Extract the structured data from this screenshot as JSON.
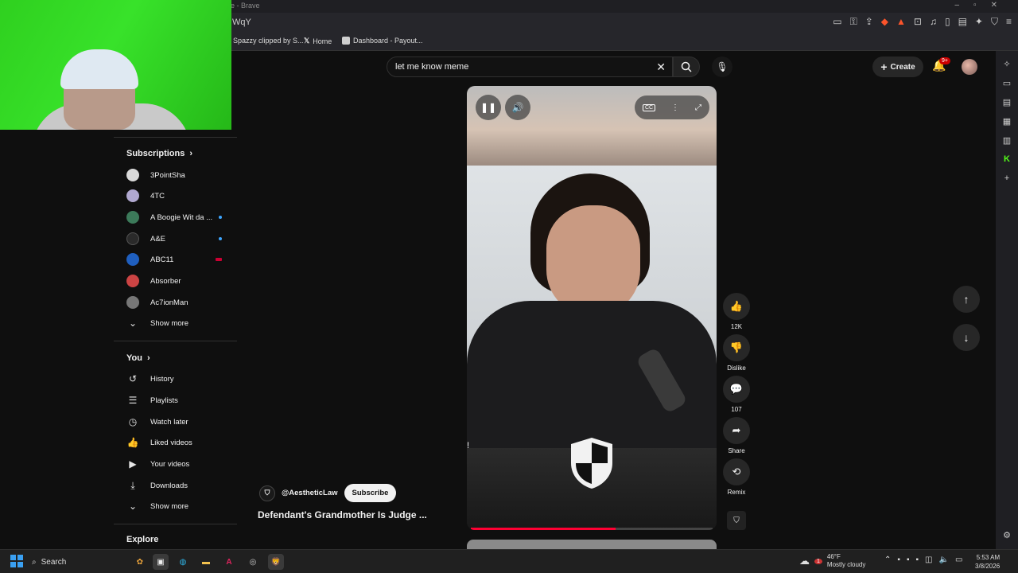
{
  "browser": {
    "window_title": "e - Brave",
    "url_fragment": "WqY",
    "bookmarks": [
      {
        "label": "Spazzy clipped by S..."
      },
      {
        "label": "Home"
      },
      {
        "label": "Dashboard - Payout..."
      }
    ]
  },
  "header": {
    "search_query": "let me know meme",
    "create_label": "Create",
    "notification_badge": "9+"
  },
  "sidebar": {
    "subscriptions_title": "Subscriptions",
    "subscriptions": [
      {
        "label": "3PointSha",
        "color": "#d9d9d9"
      },
      {
        "label": "4TC",
        "color": "#b0a8d0"
      },
      {
        "label": "A Boogie Wit da ...",
        "color": "#3c7a5a"
      },
      {
        "label": "A&E",
        "color": "#2a2a2a"
      },
      {
        "label": "ABC11",
        "color": "#1f5fbf"
      },
      {
        "label": "Absorber",
        "color": "#c44"
      },
      {
        "label": "Ac7ionMan",
        "color": "#777"
      }
    ],
    "subs_show_more": "Show more",
    "you_title": "You",
    "you_items": [
      {
        "label": "History",
        "icon": "history-icon"
      },
      {
        "label": "Playlists",
        "icon": "playlists-icon"
      },
      {
        "label": "Watch later",
        "icon": "watch-later-icon"
      },
      {
        "label": "Liked videos",
        "icon": "liked-videos-icon"
      },
      {
        "label": "Your videos",
        "icon": "your-videos-icon"
      },
      {
        "label": "Downloads",
        "icon": "downloads-icon"
      }
    ],
    "you_show_more": "Show more",
    "explore_title": "Explore"
  },
  "video": {
    "channel": "@AestheticLaw",
    "subscribe_label": "Subscribe",
    "title": "Defendant's Grandmother Is Judge ...",
    "progress": 0.6,
    "marker": "!"
  },
  "actions": {
    "likes": "12K",
    "dislike_label": "Dislike",
    "comments": "107",
    "share_label": "Share",
    "remix_label": "Remix"
  },
  "taskbar": {
    "search_label": "Search",
    "weather_temp": "46°F",
    "weather_desc": "Mostly cloudy",
    "weather_badge": "1",
    "time": "5:53 AM",
    "date": "3/8/2026"
  },
  "colors": {
    "accent": "#ff0033",
    "link": "#3ea6ff",
    "background": "#0f0f0f"
  }
}
